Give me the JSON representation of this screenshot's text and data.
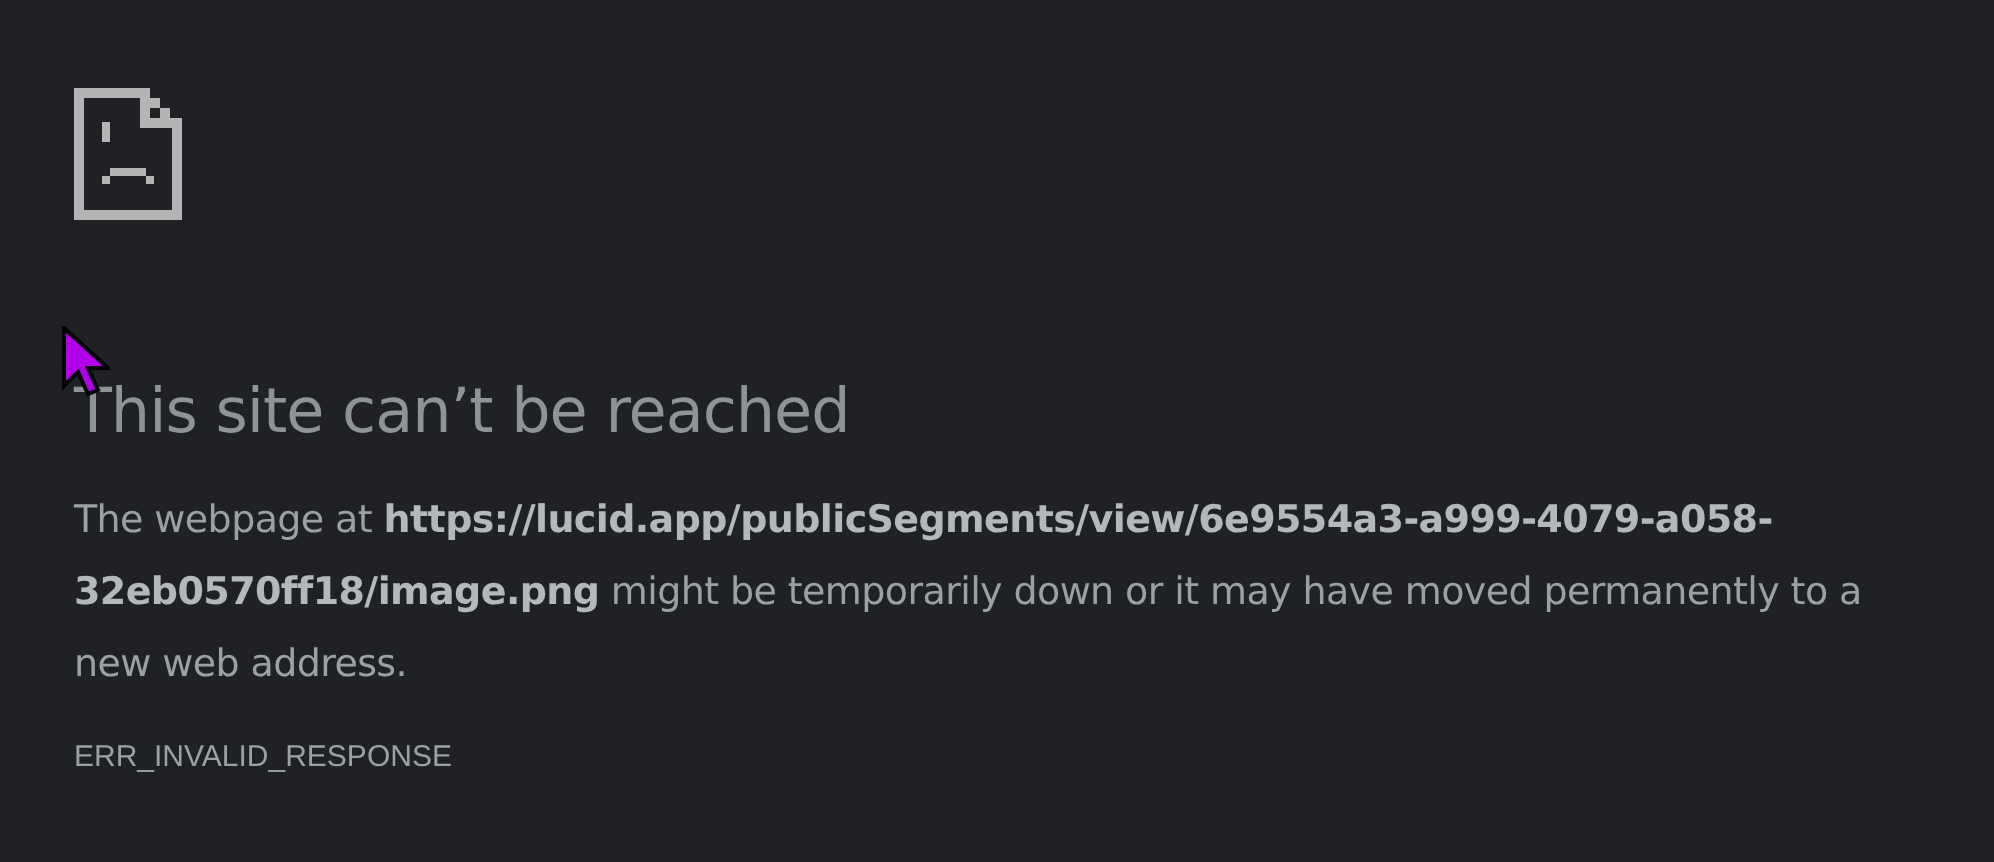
{
  "error_page": {
    "title": "This site can’t be reached",
    "message": "The webpage at **https://lucid.app/publicSegments/view/6e9554a3-a999-4079-a058-32eb0570ff18/image.png** might be temporarily down or it may have moved permanently to a new web address.",
    "error_code": "ERR_INVALID_RESPONSE"
  }
}
